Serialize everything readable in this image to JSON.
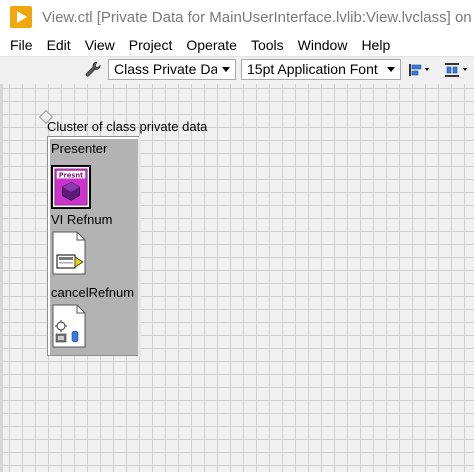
{
  "window": {
    "title": "View.ctl [Private Data for MainUserInterface.lvlib:View.lvclass] on mvplib.lvproj"
  },
  "menu": [
    "File",
    "Edit",
    "View",
    "Project",
    "Operate",
    "Tools",
    "Window",
    "Help"
  ],
  "toolbar": {
    "class_select": "Class Private Data",
    "font_select": "15pt Application Font"
  },
  "icons": {
    "app": "labview-run-icon",
    "wrench": "wrench-icon",
    "align": "align-objects-icon",
    "distribute": "distribute-objects-icon"
  },
  "cluster": {
    "label": "Cluster of class private data",
    "elements": [
      {
        "label": "Presenter",
        "icon_text": "Presnt"
      },
      {
        "label": "VI Refnum"
      },
      {
        "label": "cancelRefnum"
      },
      {
        "label": ""
      }
    ]
  },
  "colors": {
    "app_icon": "#f2a70c",
    "presenter_magenta": "#cc33cc",
    "cluster_bg": "#b3b3b3"
  }
}
